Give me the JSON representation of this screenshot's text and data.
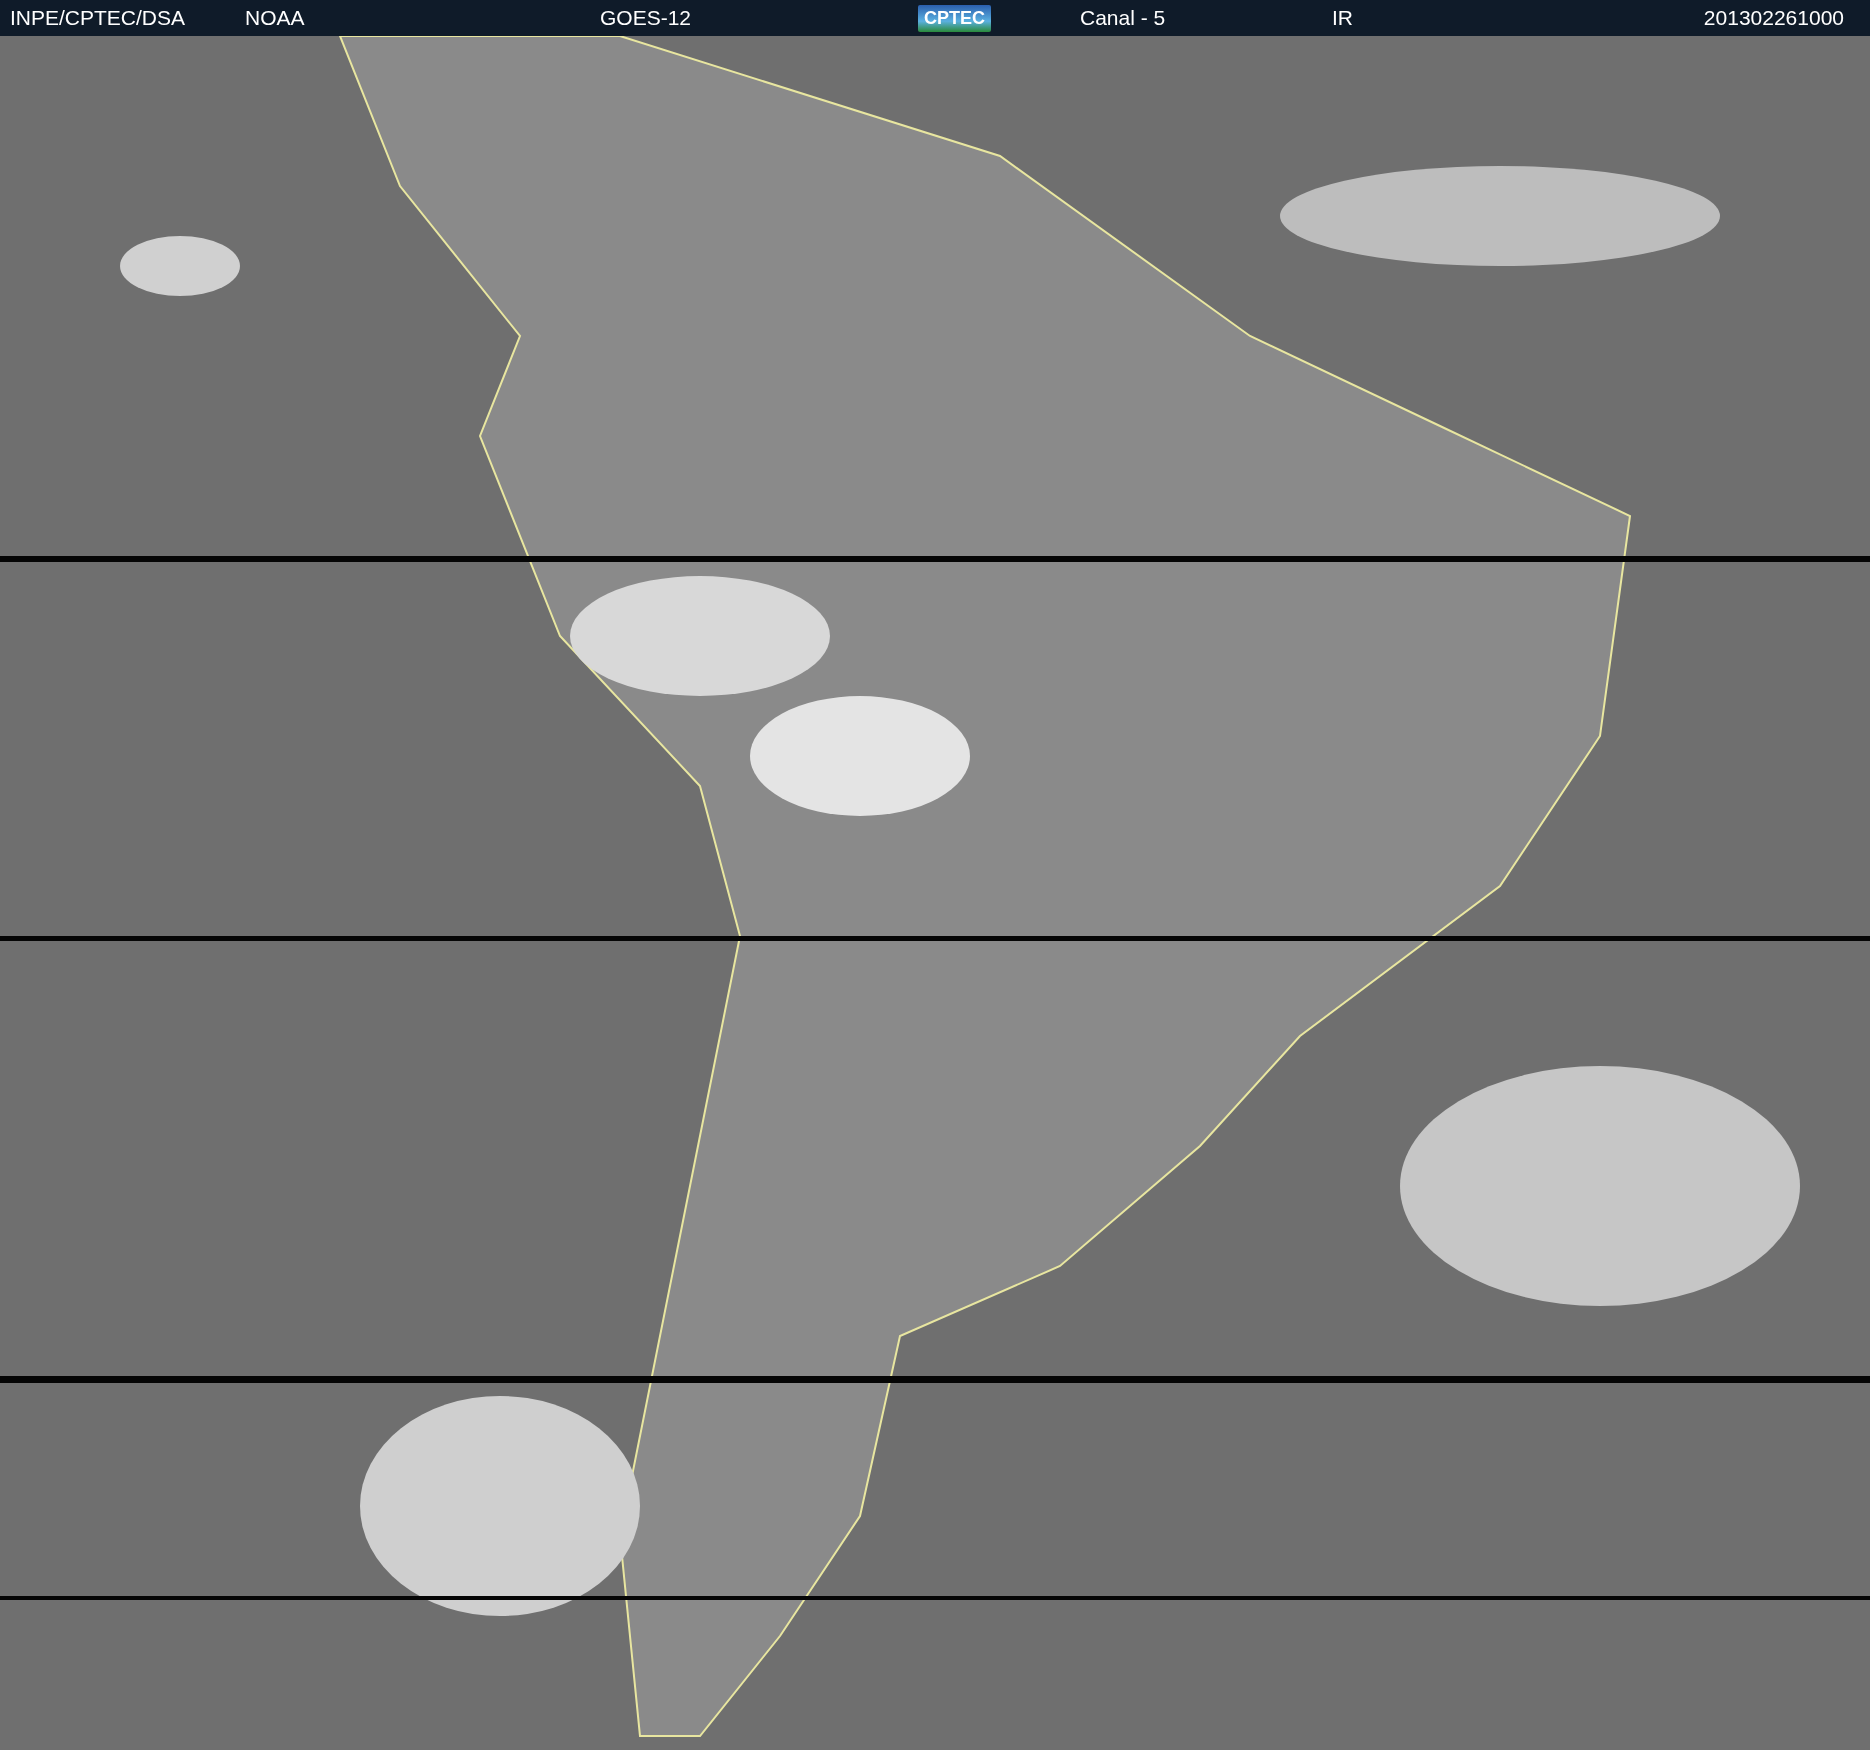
{
  "header": {
    "source": "INPE/CPTEC/DSA",
    "agency": "NOAA",
    "satellite": "GOES-12",
    "logo": "CPTEC",
    "channel": "Canal - 5",
    "band": "IR",
    "timestamp": "201302261000"
  }
}
